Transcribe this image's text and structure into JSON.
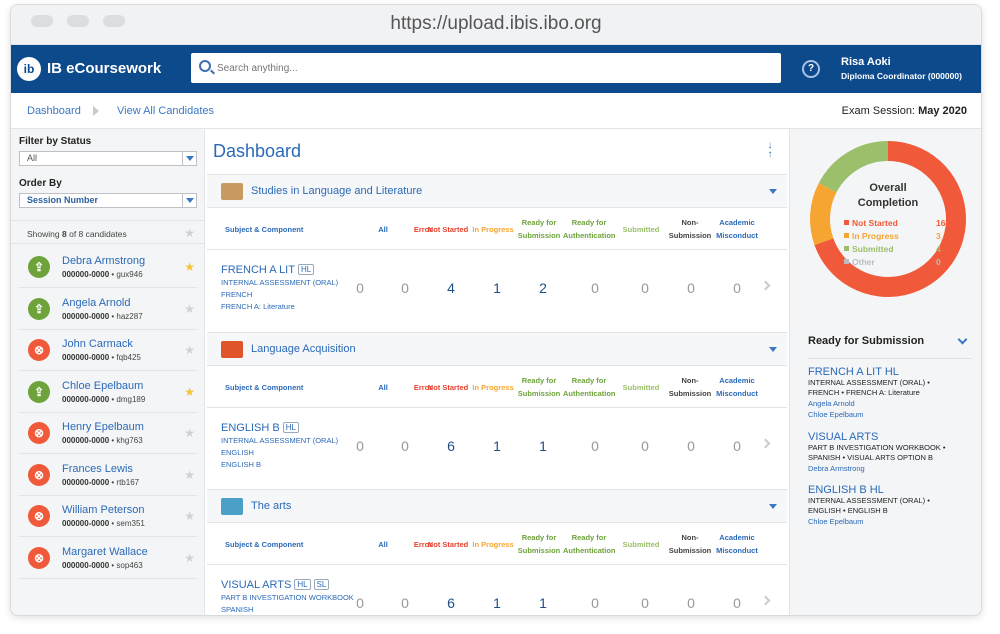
{
  "browser": {
    "url": "https://upload.ibis.ibo.org"
  },
  "app": {
    "name": "IB eCoursework",
    "logo_text": "ib"
  },
  "search": {
    "placeholder": "Search anything..."
  },
  "user": {
    "name": "Risa Aoki",
    "role": "Diploma Coordinator (000000)"
  },
  "breadcrumb": {
    "items": [
      "Dashboard",
      "View All Candidates"
    ],
    "exam_label": "Exam Session:",
    "exam_value": "May 2020"
  },
  "sidebar": {
    "filter_label": "Filter by Status",
    "filter_value": "All",
    "order_label": "Order By",
    "order_value": "Session Number",
    "showing_prefix": "Showing",
    "showing_count": "8",
    "showing_suffix": "of 8 candidates",
    "candidates": [
      {
        "name": "Debra Armstrong",
        "number": "000000-0000",
        "code": "gux946",
        "status": "upload",
        "starred": true
      },
      {
        "name": "Angela Arnold",
        "number": "000000-0000",
        "code": "haz287",
        "status": "upload",
        "starred": false
      },
      {
        "name": "John Carmack",
        "number": "000000-0000",
        "code": "fqb425",
        "status": "error",
        "starred": false
      },
      {
        "name": "Chloe Epelbaum",
        "number": "000000-0000",
        "code": "dmg189",
        "status": "upload",
        "starred": true
      },
      {
        "name": "Henry Epelbaum",
        "number": "000000-0000",
        "code": "khg763",
        "status": "error",
        "starred": false
      },
      {
        "name": "Frances Lewis",
        "number": "000000-0000",
        "code": "rtb167",
        "status": "error",
        "starred": false
      },
      {
        "name": "William Peterson",
        "number": "000000-0000",
        "code": "sem351",
        "status": "error",
        "starred": false
      },
      {
        "name": "Margaret Wallace",
        "number": "000000-0000",
        "code": "sop463",
        "status": "error",
        "starred": false
      }
    ]
  },
  "main": {
    "title": "Dashboard",
    "columns": {
      "subject": "Subject & Component",
      "all": "All",
      "error": "Error",
      "not_started": "Not Started",
      "in_progress": "In Progress",
      "ready_submission": "Ready for Submission",
      "ready_auth": "Ready for Authentication",
      "submitted": "Submitted",
      "non_submission": "Non-Submission",
      "misconduct": "Academic Misconduct"
    },
    "sections": [
      {
        "title": "Studies in Language and Literature",
        "row": {
          "subject": "FRENCH A LIT",
          "level": "HL",
          "lines": [
            "INTERNAL ASSESSMENT (ORAL)",
            "FRENCH",
            "FRENCH A: Literature"
          ],
          "values": [
            "0",
            "0",
            "4",
            "1",
            "2",
            "0",
            "0",
            "0",
            "0"
          ]
        }
      },
      {
        "title": "Language Acquisition",
        "row": {
          "subject": "ENGLISH B",
          "level": "HL",
          "lines": [
            "INTERNAL ASSESSMENT (ORAL)",
            "ENGLISH",
            "ENGLISH B"
          ],
          "values": [
            "0",
            "0",
            "6",
            "1",
            "1",
            "0",
            "0",
            "0",
            "0"
          ]
        }
      },
      {
        "title": "The arts",
        "row": {
          "subject": "VISUAL ARTS",
          "level": "HL",
          "level2": "SL",
          "lines": [
            "PART B INVESTIGATION WORKBOOK",
            "SPANISH"
          ],
          "values": [
            "0",
            "0",
            "6",
            "1",
            "1",
            "0",
            "0",
            "0",
            "0"
          ]
        }
      }
    ]
  },
  "completion": {
    "title_line1": "Overall",
    "title_line2": "Completion",
    "legend": [
      {
        "label": "Not Started",
        "value": "16",
        "color": "#f05a3a"
      },
      {
        "label": "In Progress",
        "value": "3",
        "color": "#f7a531"
      },
      {
        "label": "Submitted",
        "value": "4",
        "color": "#9bbf6a"
      },
      {
        "label": "Other",
        "value": "0",
        "color": "#b9bcc0"
      }
    ]
  },
  "ready_panel": {
    "title": "Ready for Submission",
    "items": [
      {
        "title": "FRENCH A LIT HL",
        "desc": [
          "INTERNAL ASSESSMENT (ORAL) •",
          "FRENCH • FRENCH A: Literature"
        ],
        "people": [
          "Angela Arnold",
          "Chloe Epelbaum"
        ]
      },
      {
        "title": "VISUAL ARTS",
        "desc": [
          "PART B INVESTIGATION WORKBOOK •",
          "SPANISH • VISUAL ARTS OPTION B"
        ],
        "people": [
          "Debra Armstrong"
        ]
      },
      {
        "title": "ENGLISH B HL",
        "desc": [
          "INTERNAL ASSESSMENT (ORAL) •",
          "ENGLISH • ENGLISH B"
        ],
        "people": [
          "Chloe Epelbaum"
        ]
      }
    ]
  },
  "colors": {
    "primary": "#0d4a8c",
    "link": "#2b6ab8",
    "error": "#f05a3a",
    "not_started": "#e8422e",
    "in_progress": "#f7a531",
    "ready": "#6da33a",
    "submitted": "#9bbf6a"
  }
}
